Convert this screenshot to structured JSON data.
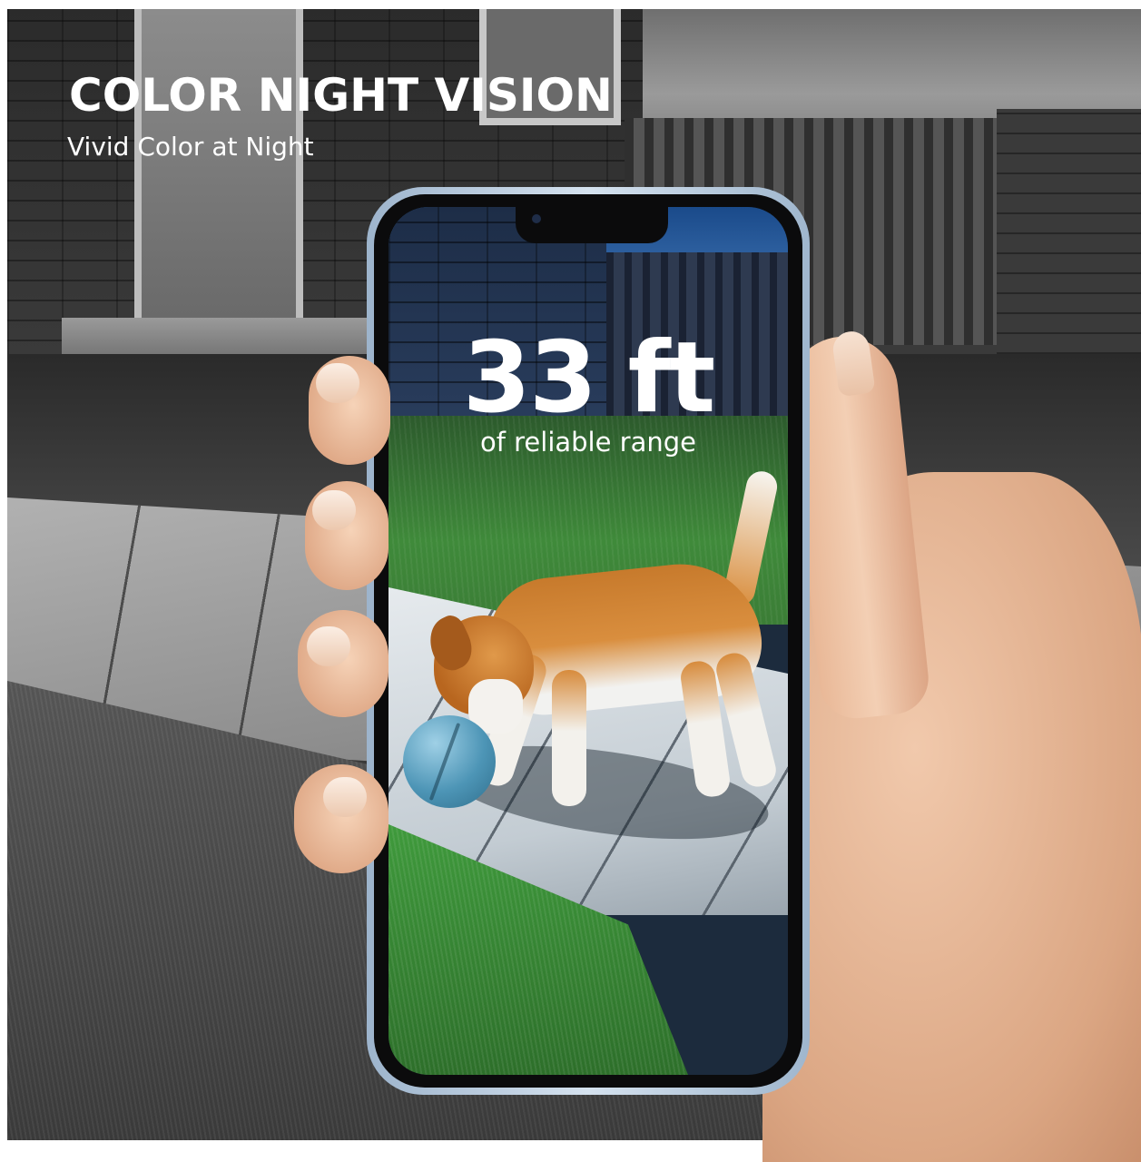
{
  "header": {
    "title": "COLOR NIGHT VISION",
    "subtitle": "Vivid Color at Night"
  },
  "phone_screen": {
    "range_value": "33 ft",
    "range_caption": "of reliable range"
  },
  "colors": {
    "text": "#ffffff",
    "phone_frame": "#c9d9ea",
    "ball": "#4d95b6",
    "dog_coat": "#d98e3e"
  }
}
